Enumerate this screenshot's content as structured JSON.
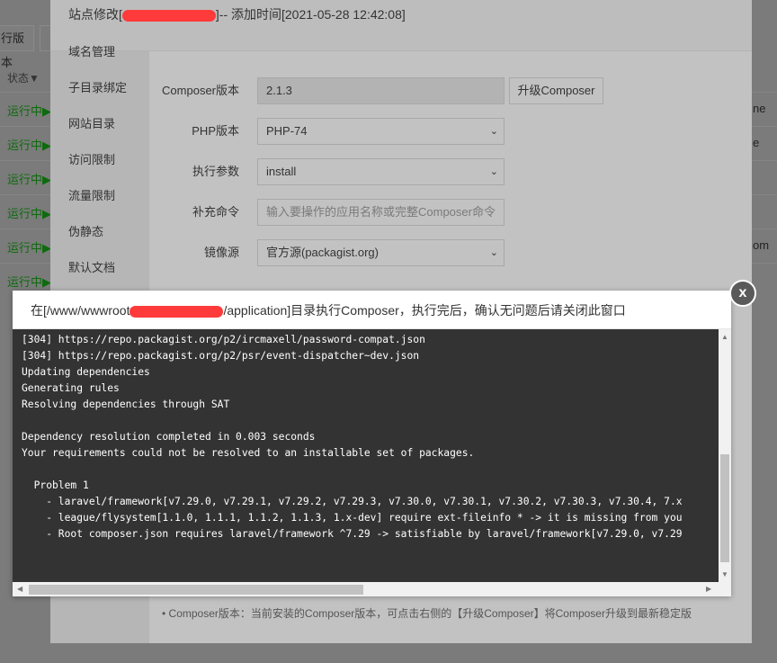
{
  "background": {
    "button": "行版本",
    "status_header": "状态▼",
    "rows": [
      {
        "status": "运行中▶",
        "right": "ne"
      },
      {
        "status": "运行中▶",
        "right": "e"
      },
      {
        "status": "运行中▶",
        "right": ""
      },
      {
        "status": "运行中▶",
        "right": ""
      },
      {
        "status": "运行中▶",
        "right": "om"
      },
      {
        "status": "运行中▶",
        "right": ""
      }
    ]
  },
  "site_modal": {
    "title_prefix": "站点修改[",
    "title_suffix": "]-- 添加时间[2021-05-28 12:42:08]",
    "sidebar": [
      "域名管理",
      "子目录绑定",
      "网站目录",
      "访问限制",
      "流量限制",
      "伪静态",
      "默认文档"
    ],
    "form": {
      "composer_version_label": "Composer版本",
      "composer_version_value": "2.1.3",
      "upgrade_button": "升级Composer",
      "php_label": "PHP版本",
      "php_value": "PHP-74",
      "args_label": "执行参数",
      "args_value": "install",
      "extra_label": "补充命令",
      "extra_placeholder": "输入要操作的应用名称或完整Composer命令",
      "mirror_label": "镜像源",
      "mirror_value": "官方源(packagist.org)"
    },
    "tip": "Composer版本：当前安装的Composer版本，可点击右侧的【升级Composer】将Composer升级到最新稳定版"
  },
  "exec_modal": {
    "title_prefix": "在[/www/wwwroot",
    "title_suffix": "/application]目录执行Composer，执行完后，确认无问题后请关闭此窗口",
    "lines": [
      "[304] https://repo.packagist.org/p2/ircmaxell/password-compat.json",
      "[304] https://repo.packagist.org/p2/psr/event-dispatcher~dev.json",
      "Updating dependencies",
      "Generating rules",
      "Resolving dependencies through SAT",
      "",
      "Dependency resolution completed in 0.003 seconds",
      "Your requirements could not be resolved to an installable set of packages.",
      "",
      "  Problem 1",
      "    - laravel/framework[v7.29.0, v7.29.1, v7.29.2, v7.29.3, v7.30.0, v7.30.1, v7.30.2, v7.30.3, v7.30.4, 7.x",
      "    - league/flysystem[1.1.0, 1.1.1, 1.1.2, 1.1.3, 1.x-dev] require ext-fileinfo * -> it is missing from you",
      "    - Root composer.json requires laravel/framework ^7.29 -> satisfiable by laravel/framework[v7.29.0, v7.29"
    ],
    "close_icon": "x"
  }
}
